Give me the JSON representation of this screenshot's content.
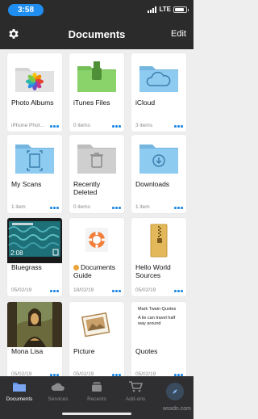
{
  "status_bar": {
    "time": "3:58",
    "network": "LTE",
    "battery_level": 0.85
  },
  "nav": {
    "title": "Documents",
    "edit_label": "Edit",
    "settings_icon": "gear-icon"
  },
  "files": [
    {
      "name": "Photo Albums",
      "sub": "iPhone Phot...",
      "icon": "photos-folder-icon"
    },
    {
      "name": "iTunes Files",
      "sub": "0 items",
      "icon": "usb-folder-icon"
    },
    {
      "name": "iCloud",
      "sub": "3 items",
      "icon": "cloud-folder-icon"
    },
    {
      "name": "My Scans",
      "sub": "1 item",
      "icon": "scan-folder-icon"
    },
    {
      "name": "Recently Deleted",
      "sub": "0 items",
      "icon": "trash-folder-icon"
    },
    {
      "name": "Downloads",
      "sub": "1 item",
      "icon": "download-folder-icon"
    },
    {
      "name": "Bluegrass",
      "sub": "05/02/19",
      "icon": "video-thumbnail",
      "duration": "2:08"
    },
    {
      "name": "Documents Guide",
      "sub": "18/02/19",
      "icon": "lifebuoy-icon",
      "tag_color": "#e8a33c"
    },
    {
      "name": "Hello World Sources",
      "sub": "05/02/19",
      "icon": "zip-archive-icon"
    },
    {
      "name": "Mona Lisa",
      "sub": "05/02/19",
      "icon": "painting-thumbnail"
    },
    {
      "name": "Picture",
      "sub": "05/02/19",
      "icon": "photo-thumbnail"
    },
    {
      "name": "Quotes",
      "sub": "05/02/19",
      "icon": "text-note-thumbnail",
      "preview_title": "Mark Twain Quotes",
      "preview_body": "A lie can travel half way around"
    }
  ],
  "tabs": [
    {
      "label": "Documents",
      "icon": "folder-icon",
      "active": true
    },
    {
      "label": "Services",
      "icon": "cloud-icon",
      "active": false
    },
    {
      "label": "Recents",
      "icon": "recents-icon",
      "active": false
    },
    {
      "label": "Add-ons",
      "icon": "cart-icon",
      "active": false
    }
  ],
  "colors": {
    "accent": "#1e88e5",
    "folder_blue": "#8ecbf1",
    "folder_green": "#8ad36b",
    "folder_grey": "#cfcfcf"
  },
  "watermark": "wsxdn.com"
}
